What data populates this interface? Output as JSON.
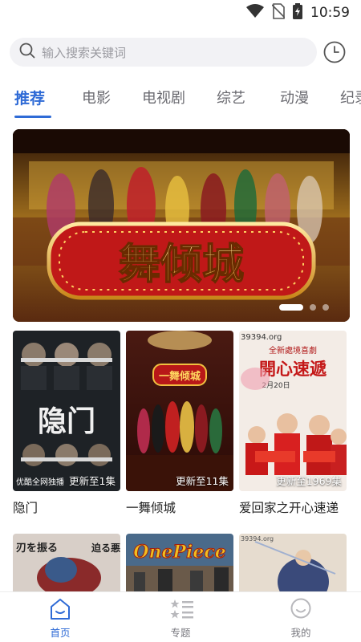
{
  "status_bar": {
    "time": "10:59"
  },
  "search": {
    "placeholder": "输入搜索关键词"
  },
  "tabs": [
    {
      "label": "推荐",
      "active": true
    },
    {
      "label": "电影",
      "active": false
    },
    {
      "label": "电视剧",
      "active": false
    },
    {
      "label": "综艺",
      "active": false
    },
    {
      "label": "动漫",
      "active": false
    },
    {
      "label": "纪录",
      "active": false
    }
  ],
  "banner": {
    "logo_text": "舞倾城",
    "slide_count": 3,
    "active_slide": 1
  },
  "cards": [
    {
      "title": "隐门",
      "badge": "更新至1集",
      "poster_text": "隐门",
      "poster_caption": "优酷全网独播"
    },
    {
      "title": "一舞倾城",
      "badge": "更新至11集",
      "poster_text": "一舞倾城"
    },
    {
      "title": "爱回家之开心速递",
      "badge": "更新至1969集",
      "poster_text": "開心速遞",
      "poster_caption": "全新處境喜劇",
      "poster_domain": "39394.org",
      "poster_date": "2月20日"
    }
  ],
  "cards_row2": [
    {
      "poster_text": "刃を振る",
      "poster_side_text": "迫る悪鬼"
    },
    {
      "poster_text": "OnePiece"
    },
    {
      "poster_domain": "39394.org"
    }
  ],
  "bottom_nav": [
    {
      "label": "首页",
      "icon": "home-icon",
      "active": true
    },
    {
      "label": "专题",
      "icon": "topic-list-icon",
      "active": false
    },
    {
      "label": "我的",
      "icon": "profile-icon",
      "active": false
    }
  ],
  "colors": {
    "accent": "#2f6bd6",
    "search_bg": "#f2f2f5",
    "tab_inactive": "#6a6a70"
  }
}
